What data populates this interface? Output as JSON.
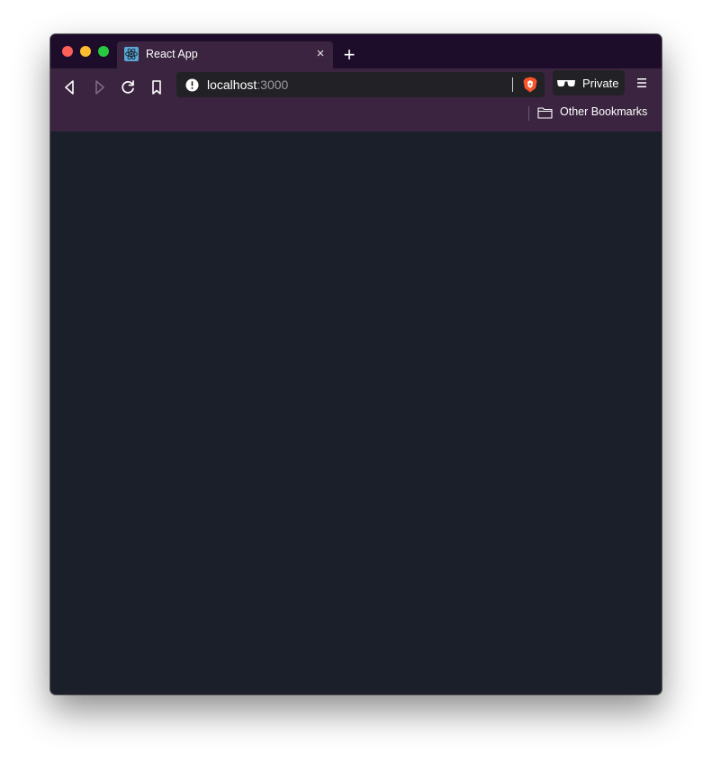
{
  "tabs": [
    {
      "title": "React App",
      "favicon": "react-logo-icon",
      "close_label": "×"
    }
  ],
  "newtab_label": "+",
  "toolbar": {
    "back_icon": "back-arrow-icon",
    "forward_icon": "forward-arrow-icon",
    "reload_icon": "reload-icon",
    "bookmark_icon": "bookmark-icon"
  },
  "address": {
    "host": "localhost",
    "port": ":3000"
  },
  "private": {
    "label": "Private"
  },
  "bookmarks_bar": {
    "folder_label": "Other Bookmarks"
  },
  "colors": {
    "titlebar": "#1e0c2b",
    "toolbar": "#3b2440",
    "content": "#1b1f29",
    "brave": "#fb542b"
  }
}
